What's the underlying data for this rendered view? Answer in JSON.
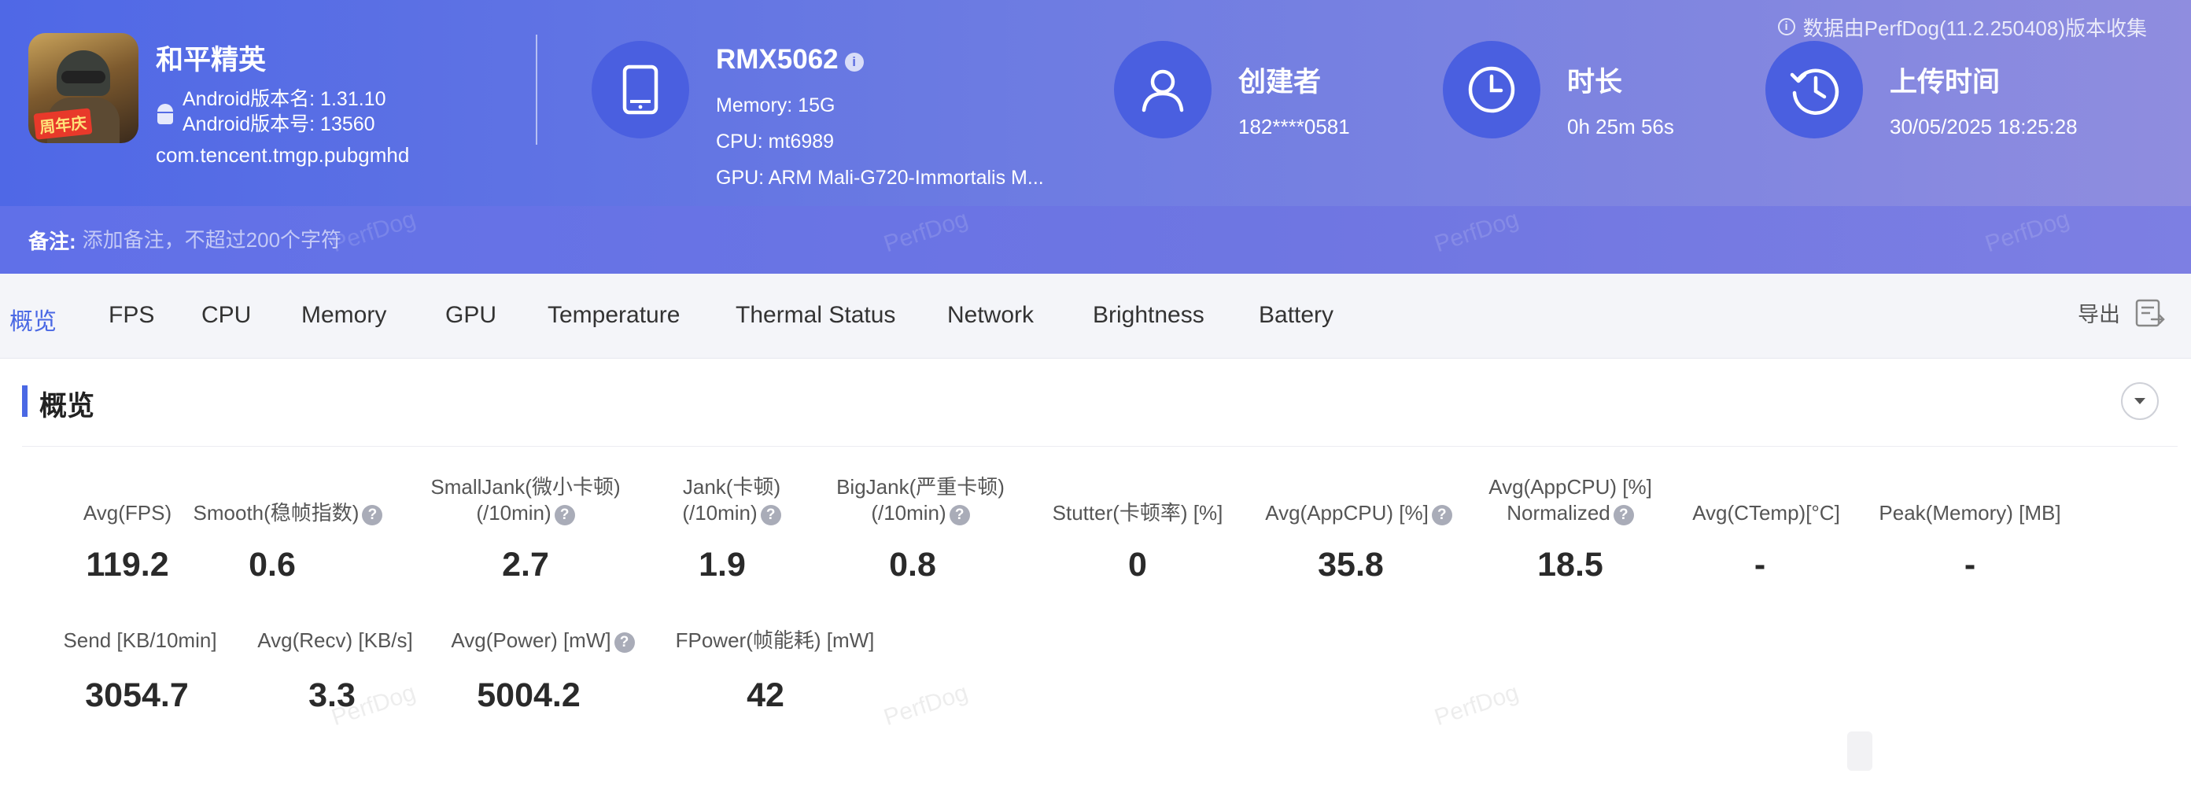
{
  "header": {
    "source_note": "数据由PerfDog(11.2.250408)版本收集",
    "app": {
      "name": "和平精英",
      "logo_badge": "周年庆",
      "android_version_name": "Android版本名: 1.31.10",
      "android_version_code": "Android版本号: 13560",
      "package": "com.tencent.tmgp.pubgmhd"
    },
    "device": {
      "model": "RMX5062",
      "memory": "Memory: 15G",
      "cpu": "CPU: mt6989",
      "gpu": "GPU: ARM Mali-G720-Immortalis M..."
    },
    "creator": {
      "title": "创建者",
      "value": "182****0581"
    },
    "duration": {
      "title": "时长",
      "value": "0h 25m 56s"
    },
    "upload": {
      "title": "上传时间",
      "value": "30/05/2025 18:25:28"
    }
  },
  "remark": {
    "label": "备注:",
    "placeholder": "添加备注，不超过200个字符"
  },
  "watermark": "PerfDog",
  "tabs": [
    "概览",
    "FPS",
    "CPU",
    "Memory",
    "GPU",
    "Temperature",
    "Thermal Status",
    "Network",
    "Brightness",
    "Battery"
  ],
  "active_tab": "概览",
  "export_label": "导出",
  "overview": {
    "title": "概览",
    "row1": [
      {
        "label": "Avg(FPS)",
        "value": "119.2"
      },
      {
        "label": "Smooth(稳帧指数)",
        "value": "0.6"
      },
      {
        "label": "SmallJank(微小卡顿)",
        "label2": "(/10min)",
        "value": "2.7"
      },
      {
        "label": "Jank(卡顿)",
        "label2": "(/10min)",
        "value": "1.9"
      },
      {
        "label": "BigJank(严重卡顿)",
        "label2": "(/10min)",
        "value": "0.8"
      },
      {
        "label": "Stutter(卡顿率) [%]",
        "value": "0"
      },
      {
        "label": "Avg(AppCPU) [%]",
        "value": "35.8"
      },
      {
        "label": "Avg(AppCPU) [%]",
        "label2": "Normalized",
        "value": "18.5"
      },
      {
        "label": "Avg(CTemp)[°C]",
        "value": "-"
      },
      {
        "label": "Peak(Memory) [MB]",
        "value": "-"
      }
    ],
    "row2": [
      {
        "label": "Send [KB/10min]",
        "value": "3054.7"
      },
      {
        "label": "Avg(Recv) [KB/s]",
        "value": "3.3"
      },
      {
        "label": "Avg(Power) [mW]",
        "value": "5004.2"
      },
      {
        "label": "FPower(帧能耗) [mW]",
        "value": "42"
      }
    ]
  },
  "colors": {
    "accent": "#4a68e4",
    "header_start": "#4f68e6",
    "header_end": "#8f8ddf",
    "icon_circle": "#4a5fe0"
  },
  "icons": [
    "info-icon",
    "android-icon",
    "tablet-icon",
    "user-icon",
    "clock-icon",
    "history-icon",
    "question-icon",
    "export-icon",
    "collapse-chevron-icon"
  ]
}
